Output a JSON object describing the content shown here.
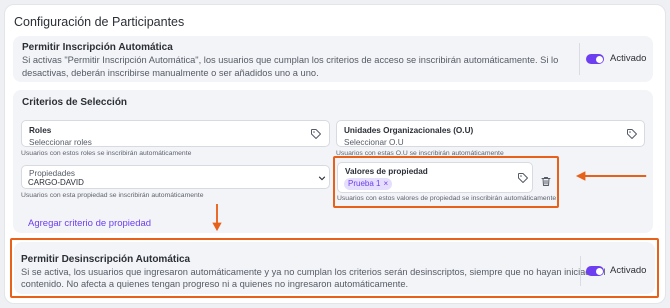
{
  "page_title": "Configuración de Participantes",
  "auto_enroll": {
    "title": "Permitir Inscripción Automática",
    "description": "Si activas \"Permitir Inscripción Automática\", los usuarios que cumplan los criterios de acceso se inscribirán automáticamente. Si lo desactivas, deberán inscribirse manualmente o ser añadidos uno a uno.",
    "toggle_label": "Activado",
    "enabled": true
  },
  "criteria": {
    "title": "Criterios de Selección",
    "roles": {
      "label": "Roles",
      "placeholder": "Seleccionar roles",
      "hint": "Usuarios con estos roles se inscribirán automáticamente"
    },
    "org_units": {
      "label": "Unidades Organizacionales (O.U)",
      "placeholder": "Seleccionar O.U",
      "hint": "Usuarios con estas O.U se inscribirán automáticamente"
    },
    "properties": {
      "label": "Propiedades",
      "value": "CARGO-DAVID",
      "hint": "Usuarios con esta propiedad se inscribirán automáticamente"
    },
    "property_values": {
      "label": "Valores de propiedad",
      "chips": [
        "Prueba 1"
      ],
      "chip_remove": "×",
      "hint": "Usuarios con estos valores de propiedad se inscribirán automáticamente"
    },
    "add_criterion": "Agregar criterio de propiedad"
  },
  "auto_unenroll": {
    "title": "Permitir Desinscripción Automática",
    "description_line1": "Si se activa, los usuarios que ingresaron automáticamente y ya no cumplan los criterios serán desinscriptos, siempre que no hayan iniciado el",
    "description_line2": "contenido. No afecta a quienes tengan progreso ni a quienes no ingresaron automáticamente.",
    "toggle_label": "Activado",
    "enabled": true
  },
  "colors": {
    "accent": "#6d3ff0",
    "highlight": "#e8611a",
    "card_bg": "#f3f4f7"
  }
}
